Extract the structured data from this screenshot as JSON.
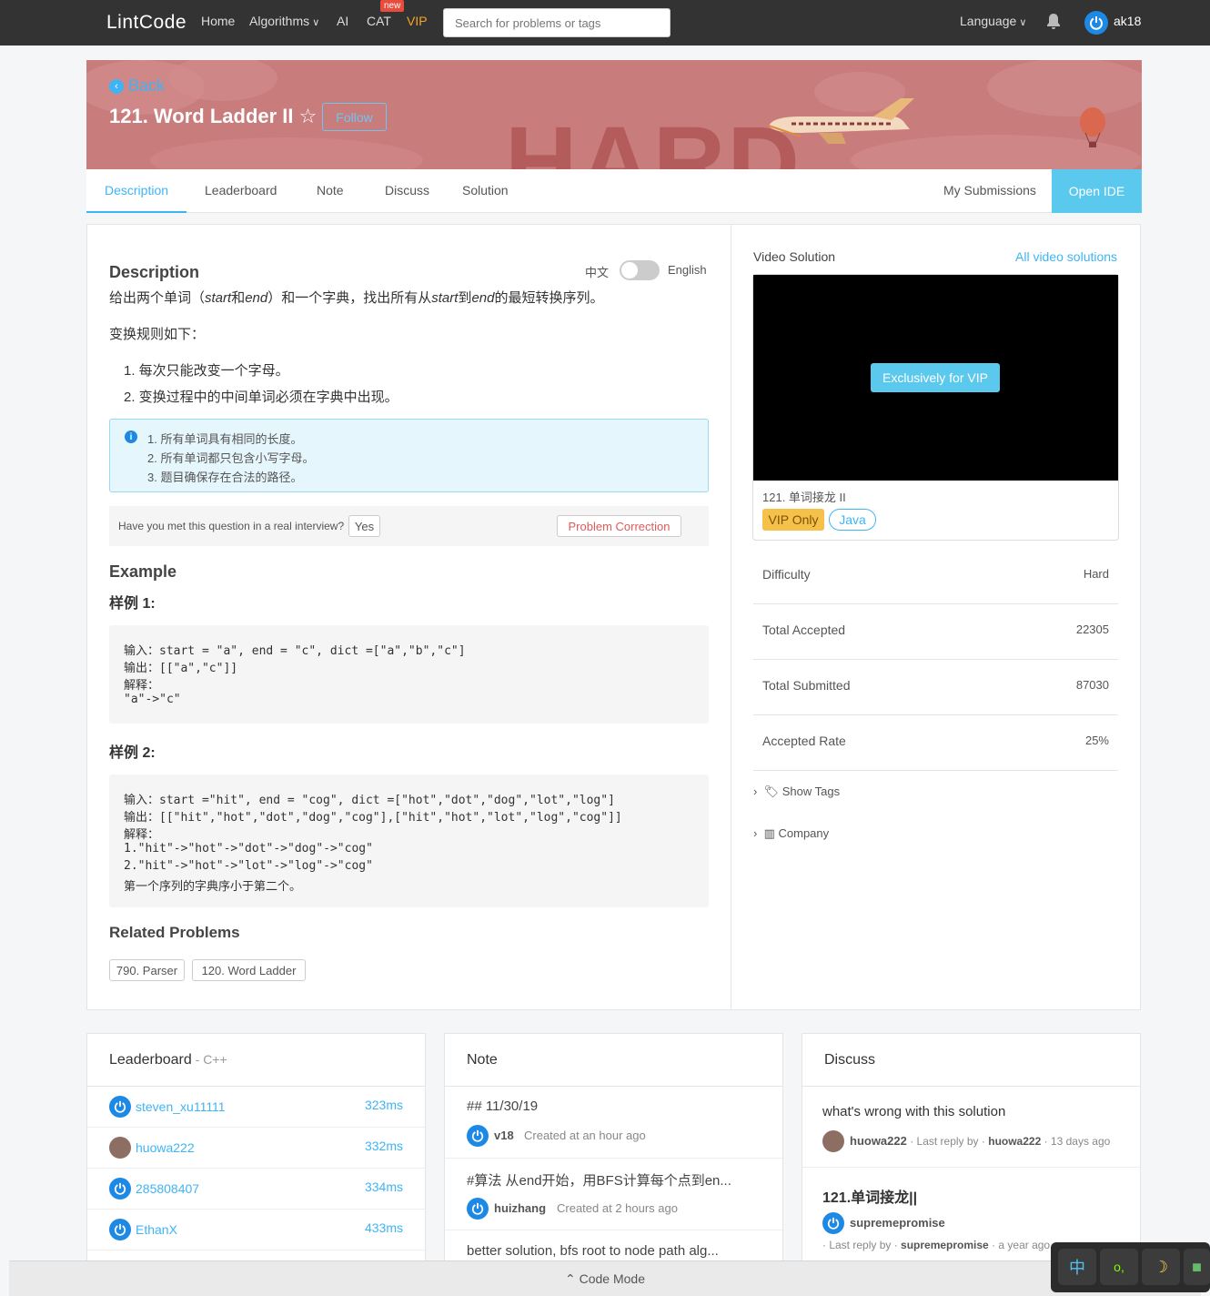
{
  "nav": {
    "logo": "LintCode",
    "home": "Home",
    "algorithms": "Algorithms",
    "ai": "AI",
    "cat": "CAT",
    "cat_badge": "new",
    "vip": "VIP",
    "search_placeholder": "Search for problems or tags",
    "language": "Language",
    "username": "ak18"
  },
  "banner": {
    "back": "Back",
    "title": "121. Word Ladder II",
    "follow": "Follow",
    "difficulty_art": "HARD"
  },
  "tabs": {
    "description": "Description",
    "leaderboard": "Leaderboard",
    "note": "Note",
    "discuss": "Discuss",
    "solution": "Solution",
    "my_submissions": "My Submissions",
    "open_ide": "Open IDE"
  },
  "problem": {
    "heading": "Description",
    "lang_cn": "中文",
    "lang_en": "English",
    "intro": [
      "给出两个单词（",
      "start",
      "和",
      "end",
      "）和一个字典，找出所有从",
      "start",
      "到",
      "end",
      "的最短转换序列。"
    ],
    "rules_title": "变换规则如下：",
    "rules": [
      "1. 每次只能改变一个字母。",
      "2. 变换过程中的中间单词必须在字典中出现。"
    ],
    "notes": [
      "1. 所有单词具有相同的长度。",
      "2. 所有单词都只包含小写字母。",
      "3. 题目确保存在合法的路径。"
    ],
    "interview_q": "Have you met this question in a real interview?",
    "yes": "Yes",
    "correction": "Problem Correction",
    "example_heading": "Example",
    "example1_title": "样例 1:",
    "example1": [
      "输入：start = \"a\", end = \"c\", dict =[\"a\",\"b\",\"c\"]",
      "输出：[[\"a\",\"c\"]]",
      "解释：",
      "\"a\"->\"c\""
    ],
    "example2_title": "样例 2:",
    "example2": [
      "输入：start =\"hit\", end = \"cog\", dict =[\"hot\",\"dot\",\"dog\",\"lot\",\"log\"]",
      "输出：[[\"hit\",\"hot\",\"dot\",\"dog\",\"cog\"],[\"hit\",\"hot\",\"lot\",\"log\",\"cog\"]]",
      "解释：",
      "1.\"hit\"->\"hot\"->\"dot\"->\"dog\"->\"cog\"",
      "2.\"hit\"->\"hot\"->\"lot\"->\"log\"->\"cog\"",
      "第一个序列的字典序小于第二个。"
    ],
    "related_heading": "Related Problems",
    "related": [
      "790. Parser",
      "120. Word Ladder"
    ]
  },
  "sidebar": {
    "video_title": "Video Solution",
    "all_videos": "All video solutions",
    "vip_button": "Exclusively for VIP",
    "video_caption": "121. 单词接龙 II",
    "vip_only": "VIP Only",
    "lang_tag": "Java",
    "stats": [
      {
        "label": "Difficulty",
        "value": "Hard"
      },
      {
        "label": "Total Accepted",
        "value": "22305"
      },
      {
        "label": "Total Submitted",
        "value": "87030"
      },
      {
        "label": "Accepted Rate",
        "value": "25%"
      }
    ],
    "show_tags": "Show Tags",
    "company": "Company"
  },
  "leaderboard": {
    "title": "Leaderboard",
    "lang": " - C++",
    "rows": [
      {
        "name": "steven_xu11111",
        "time": "323ms"
      },
      {
        "name": "huowa222",
        "time": "332ms"
      },
      {
        "name": "285808407",
        "time": "334ms"
      },
      {
        "name": "EthanX",
        "time": "433ms"
      }
    ]
  },
  "note": {
    "title": "Note",
    "items": [
      {
        "text": "## 11/30/19",
        "user": "v18",
        "meta": "Created at an hour ago"
      },
      {
        "text": "#算法 从end开始，用BFS计算每个点到en...",
        "user": "huizhang",
        "meta": "Created at 2 hours ago"
      },
      {
        "text": "better solution, bfs root to node path alg..."
      }
    ]
  },
  "discuss": {
    "title": "Discuss",
    "items": [
      {
        "title": "what's wrong with this solution",
        "user": "huowa222",
        "reply_label": " · Last reply by · ",
        "reply_user": "huowa222",
        "ago": " · 13 days ago"
      },
      {
        "title": "121.单词接龙||",
        "user": "supremepromise",
        "reply_label": " · Last reply by · ",
        "reply_user": "supremepromise",
        "ago": " · a year ago"
      }
    ]
  },
  "footer": {
    "code_mode": "Code Mode"
  },
  "ime": {
    "keys": [
      "中",
      "o,",
      "☽",
      ""
    ]
  },
  "colors": {
    "accent": "#3fb4f5",
    "banner": "#c87c7c",
    "vip": "#f5a623",
    "nav_bg": "#333333"
  }
}
